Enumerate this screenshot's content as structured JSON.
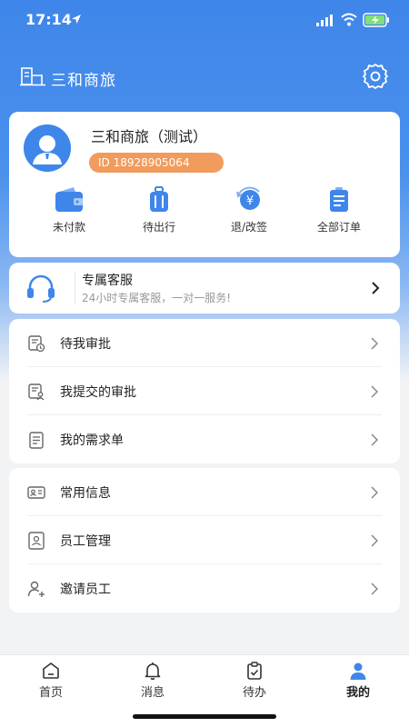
{
  "status_bar": {
    "time": "17:14"
  },
  "header": {
    "title": "三和商旅"
  },
  "profile": {
    "name": "三和商旅（测试）",
    "id_label": "ID 18928905064"
  },
  "orders": [
    {
      "label": "未付款",
      "icon": "wallet-icon"
    },
    {
      "label": "待出行",
      "icon": "luggage-icon"
    },
    {
      "label": "退/改签",
      "icon": "refund-icon"
    },
    {
      "label": "全部订单",
      "icon": "order-list-icon"
    }
  ],
  "service": {
    "title": "专属客服",
    "subtitle": "24小时专属客服，一对一服务!"
  },
  "approval_list": [
    {
      "label": "待我审批",
      "icon": "pending-approval-icon"
    },
    {
      "label": "我提交的审批",
      "icon": "submitted-approval-icon"
    },
    {
      "label": "我的需求单",
      "icon": "requisition-icon"
    }
  ],
  "info_list": [
    {
      "label": "常用信息",
      "icon": "id-card-icon"
    },
    {
      "label": "员工管理",
      "icon": "employee-icon"
    },
    {
      "label": "邀请员工",
      "icon": "invite-user-icon"
    }
  ],
  "tabbar": [
    {
      "label": "首页",
      "icon": "home-icon"
    },
    {
      "label": "消息",
      "icon": "bell-icon"
    },
    {
      "label": "待办",
      "icon": "clipboard-icon"
    },
    {
      "label": "我的",
      "icon": "user-icon"
    }
  ],
  "colors": {
    "primary": "#3f86ea",
    "badge": "#f19b5c",
    "background": "#f2f3f5"
  }
}
